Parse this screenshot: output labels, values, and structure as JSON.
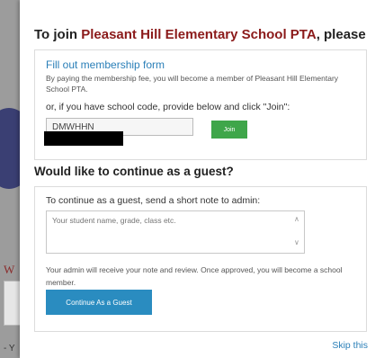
{
  "background": {
    "fragment_w": "W",
    "fragment_y": "- Y"
  },
  "join": {
    "title_prefix": "To join ",
    "school_name": "Pleasant Hill Elementary School PTA",
    "title_suffix": ", please",
    "fill_link": "Fill out membership form",
    "fee_description": "By paying the membership fee, you will become a member of Pleasant Hill Elementary School PTA.",
    "code_prompt": "or, if you have school code, provide below and click \"Join\":",
    "code_value": "DMWHHN",
    "join_label": "Join"
  },
  "guest": {
    "title": "Would like to continue as a guest?",
    "note_label": "To continue as a guest, send a short note to admin:",
    "note_placeholder": "Your student name, grade, class etc.",
    "review_text": "Your admin will receive your note and review. Once approved, you will become a school member.",
    "continue_label": "Continue As a Guest"
  },
  "skip_label": "Skip this",
  "colors": {
    "school_name": "#8b1a1a",
    "link": "#2a7fb8",
    "join_button": "#3fa64a",
    "guest_button": "#2a8cc0"
  }
}
